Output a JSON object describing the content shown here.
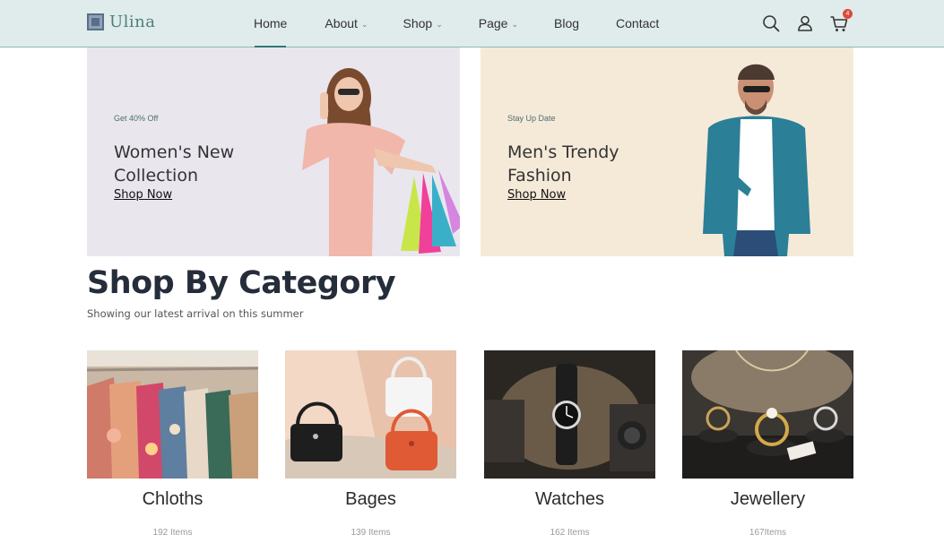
{
  "brand": {
    "name": "Ulina"
  },
  "nav": {
    "items": [
      {
        "label": "Home",
        "active": true,
        "has_dropdown": false
      },
      {
        "label": "About",
        "active": false,
        "has_dropdown": true
      },
      {
        "label": "Shop",
        "active": false,
        "has_dropdown": true
      },
      {
        "label": "Page",
        "active": false,
        "has_dropdown": true
      },
      {
        "label": "Blog",
        "active": false,
        "has_dropdown": false
      },
      {
        "label": "Contact",
        "active": false,
        "has_dropdown": false
      }
    ]
  },
  "header_icons": {
    "search": "search-icon",
    "account": "user-icon",
    "cart": "cart-icon",
    "cart_count": "4"
  },
  "banners": [
    {
      "tag": "Get 40% Off",
      "title": "Women's New Collection",
      "cta": "Shop Now"
    },
    {
      "tag": "Stay Up Date",
      "title": "Men's Trendy Fashion",
      "cta": "Shop Now"
    }
  ],
  "section": {
    "title": "Shop By Category",
    "subtitle": "Showing our latest arrival on this summer"
  },
  "categories": [
    {
      "name": "Chloths",
      "count": "192 Items"
    },
    {
      "name": "Bages",
      "count": "139 Items"
    },
    {
      "name": "Watches",
      "count": "162 Items"
    },
    {
      "name": "Jewellery",
      "count": "167Items"
    }
  ],
  "colors": {
    "header_bg": "#dfeceb",
    "accent": "#2f7a77",
    "badge": "#e0483b",
    "banner_women_bg": "#e9e6ee",
    "banner_men_bg": "#f5e9d8"
  }
}
